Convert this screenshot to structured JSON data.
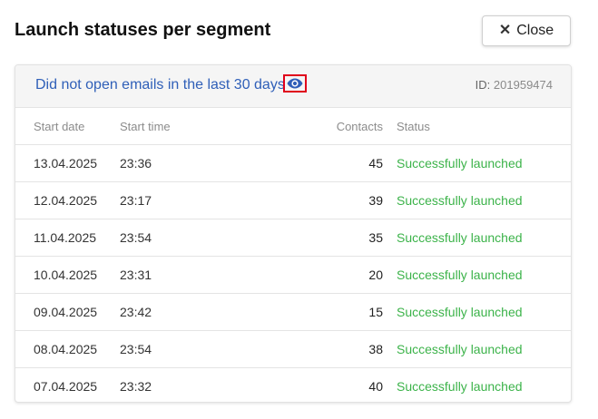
{
  "modal": {
    "title": "Launch statuses per segment",
    "close_label": "Close",
    "close_icon": "close-x-icon"
  },
  "segment": {
    "name": "Did not open emails in the last 30 days",
    "view_icon": "eye-icon",
    "id_label": "ID:",
    "id_value": "201959474"
  },
  "table": {
    "headers": [
      "Start date",
      "Start time",
      "Contacts",
      "Status"
    ],
    "rows": [
      {
        "date": "13.04.2025",
        "time": "23:36",
        "contacts": "45",
        "status": "Successfully launched"
      },
      {
        "date": "12.04.2025",
        "time": "23:17",
        "contacts": "39",
        "status": "Successfully launched"
      },
      {
        "date": "11.04.2025",
        "time": "23:54",
        "contacts": "35",
        "status": "Successfully launched"
      },
      {
        "date": "10.04.2025",
        "time": "23:31",
        "contacts": "20",
        "status": "Successfully launched"
      },
      {
        "date": "09.04.2025",
        "time": "23:42",
        "contacts": "15",
        "status": "Successfully launched"
      },
      {
        "date": "08.04.2025",
        "time": "23:54",
        "contacts": "38",
        "status": "Successfully launched"
      },
      {
        "date": "07.04.2025",
        "time": "23:32",
        "contacts": "40",
        "status": "Successfully launched"
      }
    ]
  },
  "colors": {
    "link": "#2f5fb8",
    "success": "#3cb34a",
    "highlight_border": "#e0001b"
  }
}
